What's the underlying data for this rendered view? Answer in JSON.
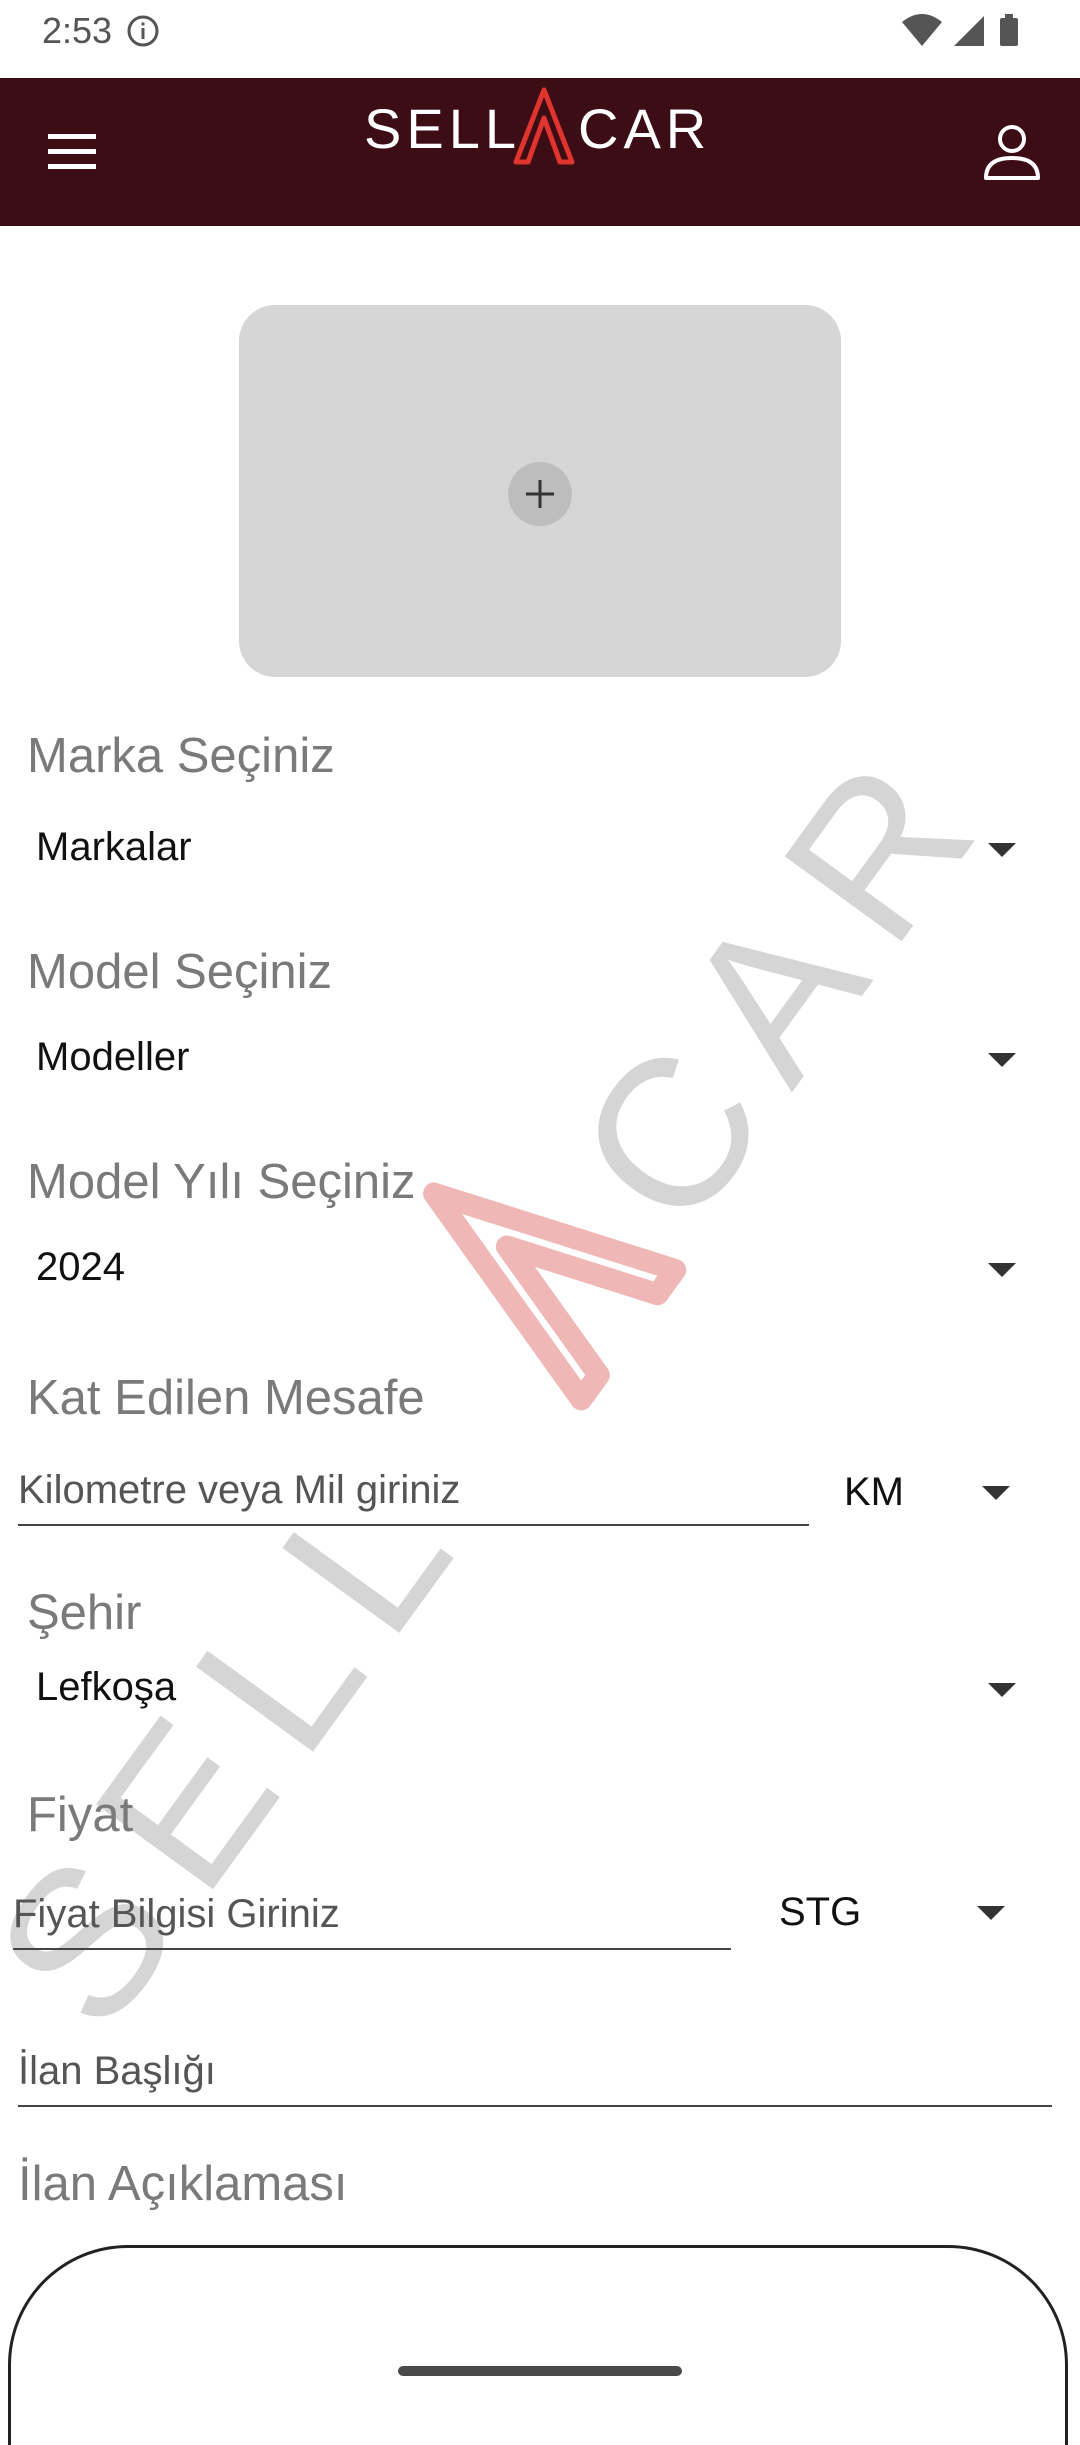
{
  "status_bar": {
    "time": "2:53",
    "icons": [
      "info-icon",
      "wifi-icon",
      "signal-icon",
      "battery-icon"
    ]
  },
  "app_bar": {
    "logo_text_left": "SELL",
    "logo_text_right": "CAR",
    "background": "#3d0d16",
    "logo_accent": "#e0342f",
    "icons": [
      "menu-icon",
      "account-icon"
    ]
  },
  "photo_upload": {
    "icon": "plus-icon"
  },
  "form": {
    "brand": {
      "label": "Marka Seçiniz",
      "value": "Markalar"
    },
    "model": {
      "label": "Model Seçiniz",
      "value": "Modeller"
    },
    "year": {
      "label": "Model Yılı Seçiniz",
      "value": "2024"
    },
    "mileage": {
      "label": "Kat Edilen Mesafe",
      "placeholder": "Kilometre veya Mil giriniz",
      "unit": "KM"
    },
    "city": {
      "label": "Şehir",
      "value": "Lefkoşa"
    },
    "price": {
      "label": "Fiyat",
      "placeholder": "Fiyat Bilgisi Giriniz",
      "currency": "STG"
    },
    "title": {
      "placeholder": "İlan Başlığı"
    },
    "description": {
      "label": "İlan Açıklaması"
    }
  },
  "watermark": {
    "text_left": "SELL",
    "text_right": "CAR",
    "color": "#c7c7c7",
    "accent": "#f0b7b7"
  }
}
